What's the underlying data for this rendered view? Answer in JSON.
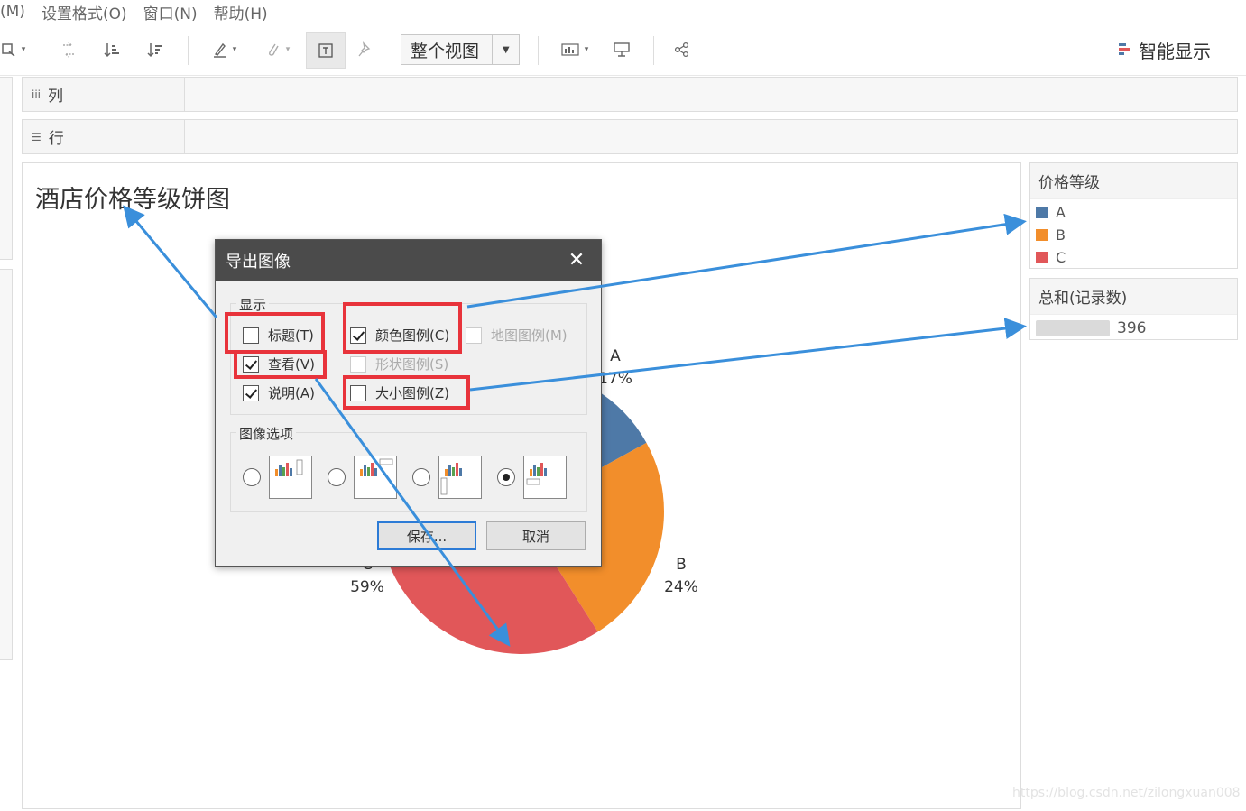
{
  "menu": [
    "(M)",
    "设置格式(O)",
    "窗口(N)",
    "帮助(H)"
  ],
  "toolbar": {
    "view_select": "整个视图",
    "smart_show": "智能显示",
    "icons": [
      "box-icon",
      "swap-icon",
      "sort-asc-icon",
      "sort-desc-icon",
      "highlight-icon",
      "clip-icon",
      "label-icon",
      "pin-icon",
      "chart-type-icon",
      "presentation-icon",
      "share-icon"
    ]
  },
  "shelves": {
    "columns": "列",
    "rows": "行"
  },
  "sheet": {
    "title": "酒店价格等级饼图"
  },
  "legend_color": {
    "title": "价格等级",
    "items": [
      {
        "label": "A",
        "color": "#4e79a7"
      },
      {
        "label": "B",
        "color": "#f28e2b"
      },
      {
        "label": "C",
        "color": "#e15759"
      }
    ]
  },
  "legend_size": {
    "title": "总和(记录数)",
    "value": "396"
  },
  "chart_data": {
    "type": "pie",
    "categories": [
      "A",
      "B",
      "C"
    ],
    "values": [
      17,
      24,
      59
    ],
    "labels": [
      {
        "name": "A",
        "pct": "17%"
      },
      {
        "name": "B",
        "pct": "24%"
      },
      {
        "name": "C",
        "pct": "59%"
      }
    ],
    "colors": [
      "#4e79a7",
      "#f28e2b",
      "#e15759"
    ]
  },
  "dialog": {
    "title": "导出图像",
    "show_group": "显示",
    "checkboxes": {
      "title_cb": {
        "label": "标题(T)",
        "checked": false
      },
      "view_cb": {
        "label": "查看(V)",
        "checked": true
      },
      "caption_cb": {
        "label": "说明(A)",
        "checked": true
      },
      "color_legend_cb": {
        "label": "颜色图例(C)",
        "checked": true
      },
      "map_legend_cb": {
        "label": "地图图例(M)",
        "checked": false
      },
      "shape_legend_cb": {
        "label": "形状图例(S)",
        "checked": false
      },
      "size_legend_cb": {
        "label": "大小图例(Z)",
        "checked": false
      }
    },
    "image_group": "图像选项",
    "save_label": "保存...",
    "cancel_label": "取消"
  },
  "watermark": "https://blog.csdn.net/zilongxuan008",
  "annotation_color": "#e8333b",
  "arrow_color": "#3a8fdb"
}
